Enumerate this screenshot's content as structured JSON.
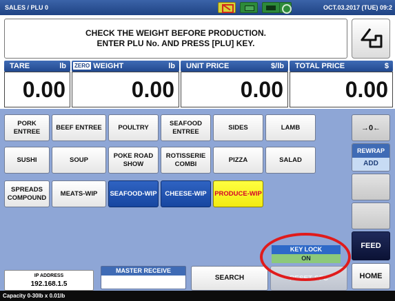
{
  "topbar": {
    "title": "SALES / PLU 0",
    "datetime": "OCT.03.2017 (TUE) 09:2",
    "status_icons": [
      "print-icon",
      "label-icon",
      "battery-icon",
      "network-icon"
    ]
  },
  "message": {
    "line1": "CHECK THE WEIGHT BEFORE PRODUCTION.",
    "line2": "ENTER PLU No. AND PRESS [PLU] KEY."
  },
  "back_icon": "return-arrow-icon",
  "readouts": {
    "tare": {
      "label": "TARE",
      "unit": "lb",
      "value": "0.00"
    },
    "weight": {
      "zero_badge": "ZERO",
      "label": "WEIGHT",
      "unit": "lb",
      "value": "0.00"
    },
    "unit_price": {
      "label": "UNIT PRICE",
      "unit": "$/lb",
      "value": "0.00"
    },
    "total_price": {
      "label": "TOTAL PRICE",
      "unit": "$",
      "value": "0.00"
    }
  },
  "keys": [
    [
      "PORK ENTREE",
      "BEEF ENTREE",
      "POULTRY",
      "SEAFOOD ENTREE",
      "SIDES",
      "LAMB"
    ],
    [
      "SUSHI",
      "SOUP",
      "POKE ROAD SHOW",
      "ROTISSERIE COMBI",
      "PIZZA",
      "SALAD"
    ],
    [
      "SPREADS COMPOUND",
      "MEATS-WIP",
      "SEAFOOD-WIP",
      "CHEESE-WIP",
      "PRODUCE-WIP"
    ]
  ],
  "side": {
    "zero_key": "→0←",
    "rewrap": "REWRAP",
    "add": "ADD",
    "feed": "FEED",
    "home": "HOME"
  },
  "key_lock": {
    "label": "KEY LOCK",
    "state": "ON"
  },
  "footer": {
    "ip_label": "IP ADDRESS",
    "ip_value": "192.168.1.5",
    "master_receive": "MASTER RECEIVE",
    "search": "SEARCH",
    "reset_sfc": "RESET SFC",
    "capacity": "Capacity 0-30lb x 0.01lb"
  },
  "colors": {
    "header_blue": "#1f4384",
    "panel_bg": "#8ea6d6",
    "highlight_ring": "#e01b1b",
    "yellow_key": "#f2ea10"
  }
}
